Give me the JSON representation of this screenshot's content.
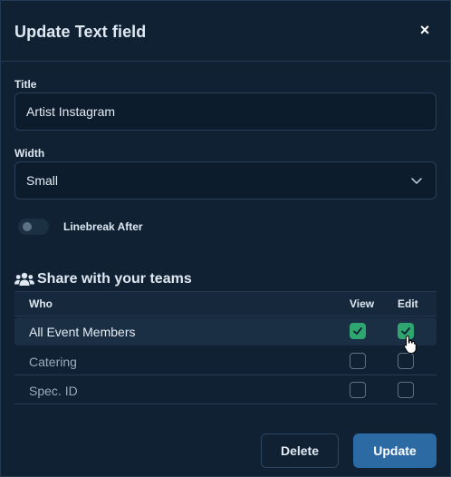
{
  "dialog": {
    "title": "Update Text field",
    "close_symbol": "×"
  },
  "title_field": {
    "label": "Title",
    "value": "Artist Instagram"
  },
  "width_field": {
    "label": "Width",
    "value": "Small"
  },
  "linebreak": {
    "label": "Linebreak After",
    "enabled": false
  },
  "share": {
    "heading": "Share with your teams",
    "icon": "users-icon",
    "columns": {
      "who": "Who",
      "view": "View",
      "edit": "Edit"
    },
    "rows": [
      {
        "who": "All Event Members",
        "view": true,
        "edit": true
      },
      {
        "who": "Catering",
        "view": false,
        "edit": false
      },
      {
        "who": "Spec. ID",
        "view": false,
        "edit": false
      }
    ]
  },
  "footer": {
    "delete_label": "Delete",
    "update_label": "Update"
  },
  "colors": {
    "background": "#0f2133",
    "accent": "#2b6aa3",
    "check": "#2fa66f"
  }
}
